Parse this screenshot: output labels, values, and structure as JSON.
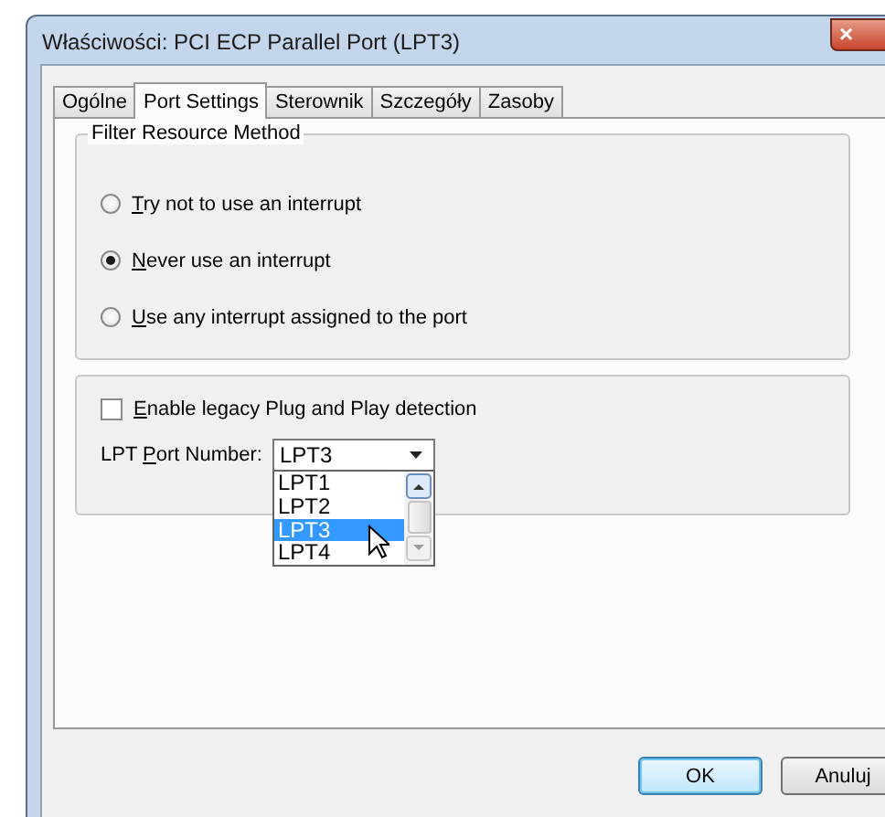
{
  "window": {
    "title": "Właściwości: PCI ECP Parallel Port (LPT3)",
    "close": "×"
  },
  "tabs": [
    {
      "label": "Ogólne",
      "selected": false
    },
    {
      "label": "Port Settings",
      "selected": true
    },
    {
      "label": "Sterownik",
      "selected": false
    },
    {
      "label": "Szczegóły",
      "selected": false
    },
    {
      "label": "Zasoby",
      "selected": false
    }
  ],
  "filter_group": {
    "title": "Filter Resource Method",
    "options": [
      {
        "label": {
          "key": "T",
          "after": "ry not to use an interrupt"
        },
        "selected": false
      },
      {
        "label": {
          "key": "N",
          "after": "ever use an interrupt"
        },
        "selected": true
      },
      {
        "label": {
          "key": "U",
          "after": "se any interrupt assigned to the port"
        },
        "selected": false
      }
    ]
  },
  "legacy_checkbox": {
    "label": {
      "key": "E",
      "after": "nable legacy Plug and Play detection"
    },
    "checked": false
  },
  "lpt_port": {
    "label": {
      "before": "LPT ",
      "key": "P",
      "after": "ort Number:"
    },
    "value": "LPT3",
    "expanded": true,
    "options": [
      {
        "label": "LPT1",
        "selected": false
      },
      {
        "label": "LPT2",
        "selected": false
      },
      {
        "label": "LPT3",
        "selected": true
      },
      {
        "label": "LPT4",
        "selected": false
      }
    ]
  },
  "buttons": [
    {
      "label": "OK",
      "kind": "default"
    },
    {
      "label": "Anuluj",
      "kind": "normal"
    }
  ]
}
